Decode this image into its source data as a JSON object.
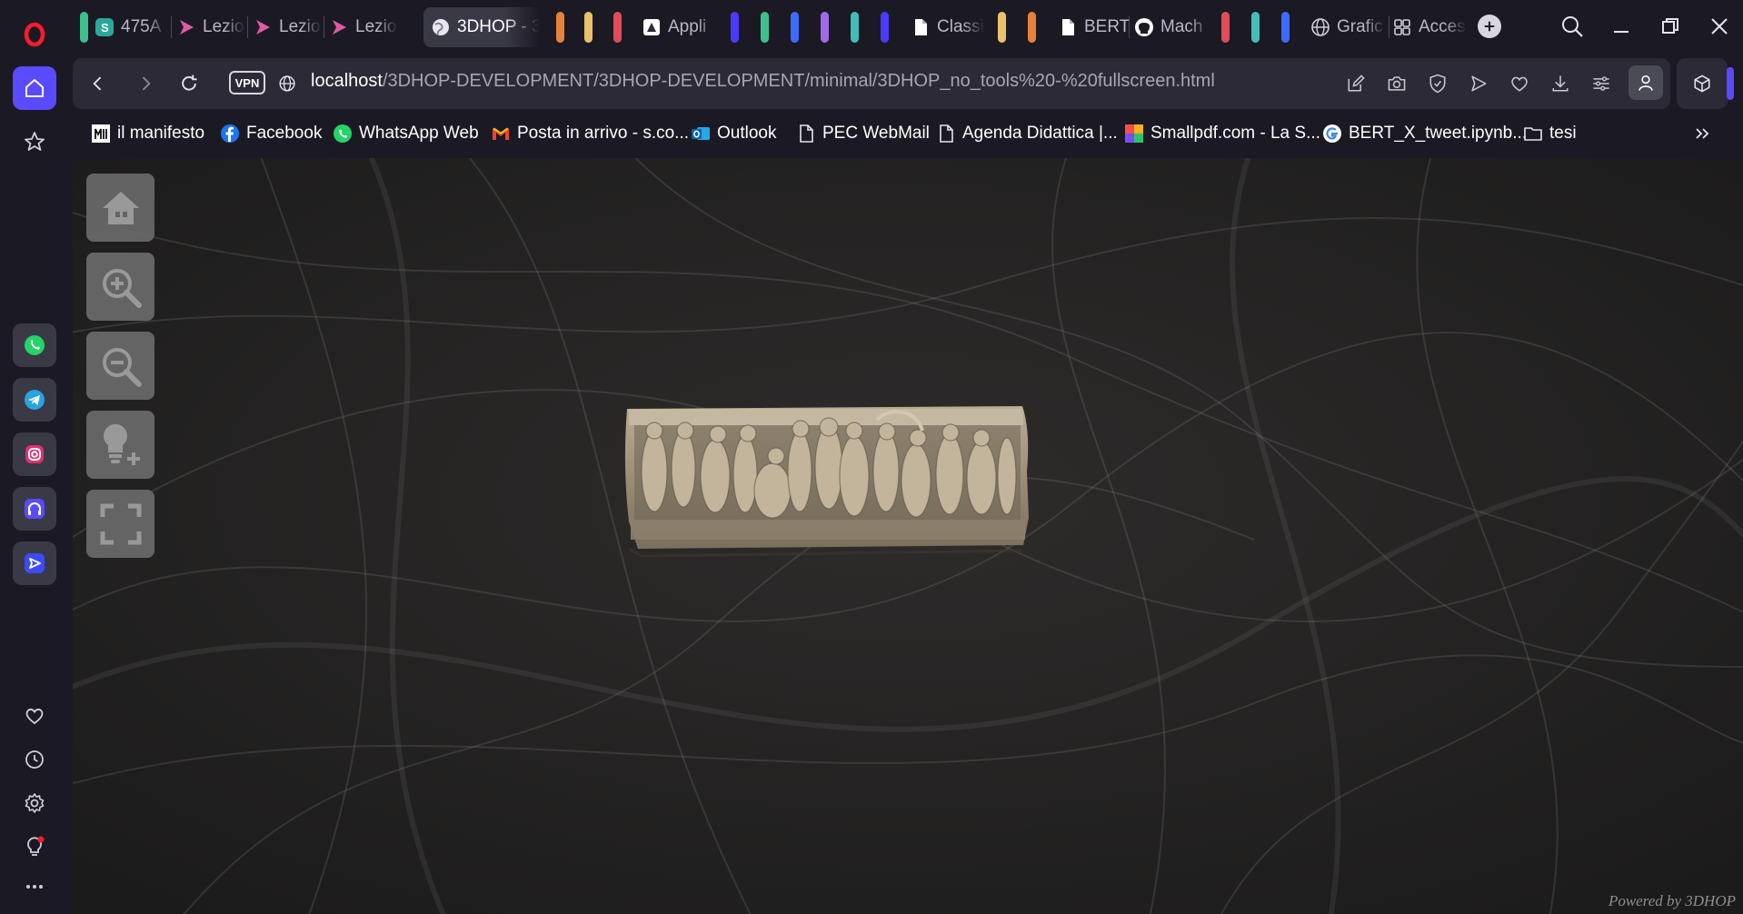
{
  "sidebar": {
    "items": [
      {
        "name": "opera-logo"
      },
      {
        "name": "speed-dial-home"
      },
      {
        "name": "pinboards"
      },
      {
        "name": "whatsapp"
      },
      {
        "name": "telegram"
      },
      {
        "name": "instagram"
      },
      {
        "name": "music-player"
      },
      {
        "name": "player"
      },
      {
        "name": "bookmarks-heart"
      },
      {
        "name": "history"
      },
      {
        "name": "settings"
      },
      {
        "name": "tips"
      },
      {
        "name": "more"
      }
    ]
  },
  "tabs": [
    {
      "label": "475A",
      "icon": "s-app-icon"
    },
    {
      "label": "Lezior",
      "icon": "play-arrow-icon"
    },
    {
      "label": "Lezior",
      "icon": "play-arrow-icon"
    },
    {
      "label": "Lezior",
      "icon": "play-arrow-icon"
    },
    {
      "label": "3DHOP - 3",
      "icon": "globe-icon",
      "active": true
    },
    {
      "label": "Appli",
      "icon": "app-icon"
    },
    {
      "label": "Classi",
      "icon": "document-icon"
    },
    {
      "label": "BERT",
      "icon": "document-icon"
    },
    {
      "label": "Mach",
      "icon": "github-icon"
    },
    {
      "label": "Grafic",
      "icon": "globe-icon"
    },
    {
      "label": "Acces",
      "icon": "grid-icon"
    }
  ],
  "tab_islands": [
    "#e8823a",
    "#e8c36a",
    "#e24c5a",
    "#4a3bff",
    "#3ec08c",
    "#3d6bff",
    "#a06ae8",
    "#44bdb8",
    "#4a3bff",
    "#e8c36a",
    "#e8823a",
    "#e24c5a",
    "#44bdb8",
    "#3d6bff"
  ],
  "address": {
    "vpn_label": "VPN",
    "url_host": "localhost",
    "url_path": "/3DHOP-DEVELOPMENT/3DHOP-DEVELOPMENT/minimal/3DHOP_no_tools%20-%20fullscreen.html"
  },
  "bookmarks": [
    {
      "label": "il manifesto",
      "icon": "manifesto-icon"
    },
    {
      "label": "Facebook",
      "icon": "facebook-icon"
    },
    {
      "label": "WhatsApp Web",
      "icon": "whatsapp-icon"
    },
    {
      "label": "Posta in arrivo - s.co...",
      "icon": "gmail-icon"
    },
    {
      "label": "Outlook",
      "icon": "outlook-icon"
    },
    {
      "label": "PEC WebMail",
      "icon": "document-icon"
    },
    {
      "label": "Agenda Didattica |...",
      "icon": "document-icon"
    },
    {
      "label": "Smallpdf.com - La S...",
      "icon": "smallpdf-icon"
    },
    {
      "label": "BERT_X_tweet.ipynb...",
      "icon": "google-icon"
    },
    {
      "label": "tesi",
      "icon": "folder-icon"
    }
  ],
  "viewer": {
    "tools": [
      "home",
      "zoom-in",
      "zoom-out",
      "light",
      "fullscreen"
    ],
    "powered_by": "Powered by 3DHOP"
  },
  "colors": {
    "accent": "#5a4bff",
    "chrome_bg": "#1b1a24",
    "bar_bg": "#2b2a36",
    "opera_red": "#ff1b2d"
  }
}
